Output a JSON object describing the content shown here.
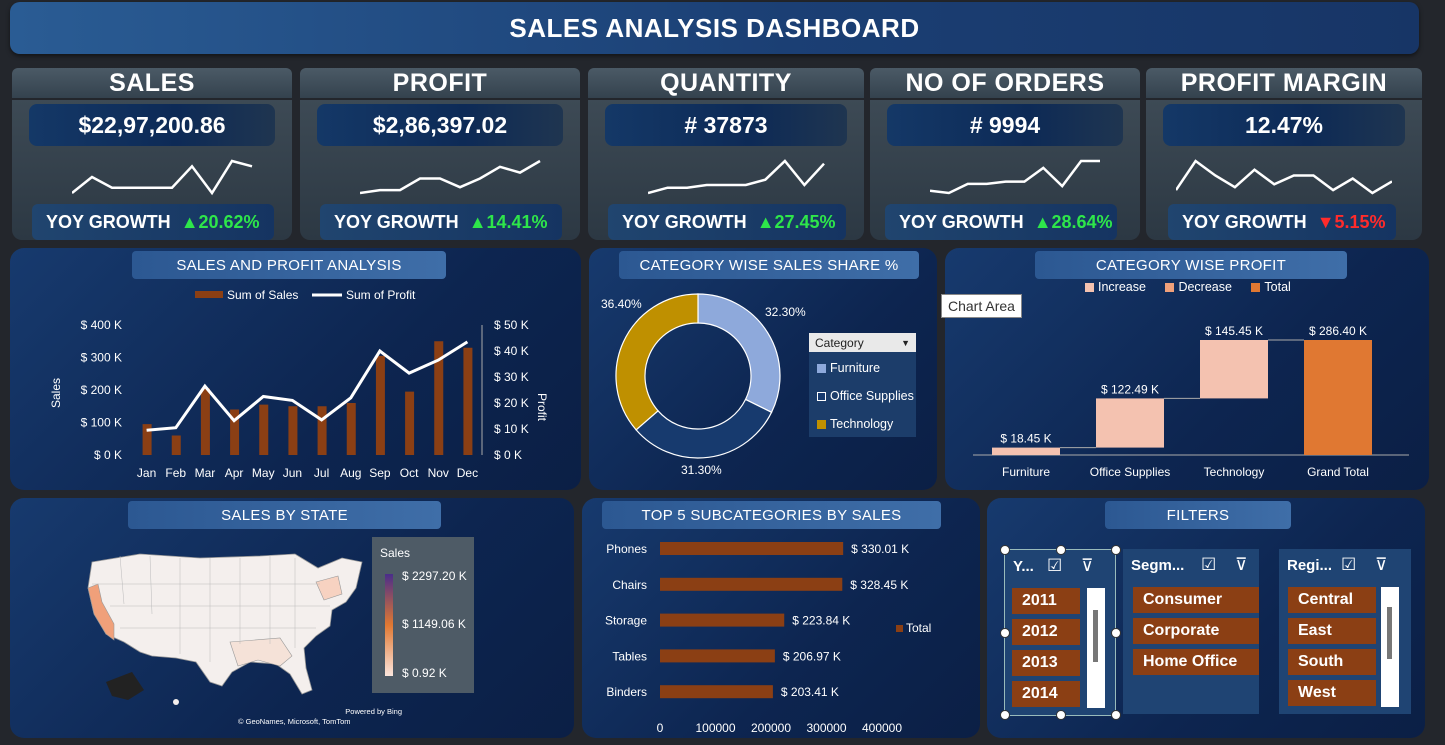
{
  "title": "SALES ANALYSIS DASHBOARD",
  "kpis": [
    {
      "label": "SALES",
      "value": "$22,97,200.86",
      "yoy_label": "YOY GROWTH",
      "yoy": "▲20.62%",
      "trend": "up",
      "spark": [
        4,
        7,
        5,
        5,
        5,
        5,
        9,
        4,
        10,
        9
      ]
    },
    {
      "label": "PROFIT",
      "value": "$2,86,397.02",
      "yoy_label": "YOY GROWTH",
      "yoy": "▲14.41%",
      "trend": "up",
      "spark": [
        3,
        4,
        4,
        8,
        8,
        5,
        8,
        12,
        10,
        14
      ]
    },
    {
      "label": "QUANTITY",
      "value": "# 37873",
      "yoy_label": "YOY GROWTH",
      "yoy": "▲27.45%",
      "trend": "up",
      "spark": [
        3,
        5,
        5,
        6,
        6,
        6,
        8,
        15,
        6,
        14
      ]
    },
    {
      "label": "NO OF ORDERS",
      "value": "# 9994",
      "yoy_label": "YOY GROWTH",
      "yoy": "▲28.64%",
      "trend": "up",
      "spark": [
        3,
        2,
        6,
        6,
        7,
        7,
        13,
        5,
        16,
        16
      ]
    },
    {
      "label": "PROFIT MARGIN",
      "value": "12.47%",
      "yoy_label": "YOY GROWTH",
      "yoy": "▼5.15%",
      "trend": "down",
      "spark": [
        3,
        13,
        8,
        4,
        10,
        5,
        8,
        8,
        3,
        7,
        2,
        6
      ]
    }
  ],
  "sales_profit": {
    "title": "SALES AND PROFIT ANALYSIS",
    "legend_sales": "Sum of Sales",
    "legend_profit": "Sum of Profit",
    "ylabel_left": "Sales",
    "ylabel_right": "Profit",
    "y_left_ticks": [
      "$ 0 K",
      "$ 100 K",
      "$ 200 K",
      "$ 300 K",
      "$ 400 K"
    ],
    "y_right_ticks": [
      "$ 0 K",
      "$ 10 K",
      "$ 20 K",
      "$ 30 K",
      "$ 40 K",
      "$ 50 K"
    ]
  },
  "chart_data": [
    {
      "type": "bar",
      "title": "SALES AND PROFIT ANALYSIS",
      "categories": [
        "Jan",
        "Feb",
        "Mar",
        "Apr",
        "May",
        "Jun",
        "Jul",
        "Aug",
        "Sep",
        "Oct",
        "Nov",
        "Dec"
      ],
      "series": [
        {
          "name": "Sum of Sales",
          "axis": "left",
          "kind": "bar",
          "values": [
            95,
            60,
            205,
            140,
            155,
            150,
            150,
            160,
            305,
            195,
            350,
            330
          ]
        },
        {
          "name": "Sum of Profit",
          "axis": "right",
          "kind": "line",
          "values": [
            9.5,
            10.5,
            26.5,
            13.2,
            22.5,
            21,
            13.5,
            22,
            40,
            31.5,
            36.5,
            43.5
          ]
        }
      ],
      "ylim_left": [
        0,
        400
      ],
      "ylim_right": [
        0,
        50
      ],
      "xlabel": "",
      "ylabel": "Sales",
      "ylabel_right": "Profit"
    },
    {
      "type": "pie",
      "title": "CATEGORY WISE SALES SHARE %",
      "categories": [
        "Furniture",
        "Office Supplies",
        "Technology"
      ],
      "values": [
        32.3,
        31.3,
        36.4
      ],
      "labels": [
        "32.30%",
        "31.30%",
        "36.40%"
      ],
      "colors": [
        "#8ea9db",
        "#173a6e",
        "#bf9000"
      ]
    },
    {
      "type": "bar",
      "subtype": "waterfall",
      "title": "CATEGORY WISE PROFIT",
      "categories": [
        "Furniture",
        "Office Supplies",
        "Technology",
        "Grand Total"
      ],
      "values": [
        18.45,
        122.49,
        145.45,
        286.4
      ],
      "labels": [
        "$ 18.45 K",
        "$ 122.49 K",
        "$ 145.45 K",
        "$ 286.40 K"
      ],
      "kinds": [
        "increase",
        "increase",
        "increase",
        "total"
      ],
      "legend": [
        "Increase",
        "Decrease",
        "Total"
      ]
    },
    {
      "type": "bar",
      "orientation": "horizontal",
      "title": "TOP 5 SUBCATEGORIES BY SALES",
      "categories": [
        "Phones",
        "Chairs",
        "Storage",
        "Tables",
        "Binders"
      ],
      "values": [
        330007,
        328449,
        223844,
        206966,
        203413
      ],
      "labels": [
        "$ 330.01 K",
        "$ 328.45 K",
        "$ 223.84 K",
        "$ 206.97 K",
        "$ 203.41 K"
      ],
      "x_ticks": [
        "0",
        "100000",
        "200000",
        "300000",
        "400000"
      ],
      "xlim": [
        0,
        400000
      ],
      "legend": "Total"
    }
  ],
  "category_share": {
    "title": "CATEGORY WISE SALES SHARE %",
    "legend_header": "Category",
    "legend": [
      "Furniture",
      "Office Supplies",
      "Technology"
    ],
    "tooltip": "Chart Area"
  },
  "category_profit": {
    "title": "CATEGORY WISE PROFIT",
    "legend": [
      "Increase",
      "Decrease",
      "Total"
    ]
  },
  "map": {
    "title": "SALES BY STATE",
    "legend_title": "Sales",
    "legend_max": "$ 2297.20 K",
    "legend_mid": "$ 1149.06 K",
    "legend_min": "$ 0.92 K",
    "credit1": "Powered by Bing",
    "credit2": "© GeoNames, Microsoft, TomTom"
  },
  "top5": {
    "title": "TOP 5 SUBCATEGORIES BY SALES",
    "legend": "Total"
  },
  "filters": {
    "title": "FILTERS",
    "year": {
      "header": "Y...",
      "items": [
        "2011",
        "2012",
        "2013",
        "2014"
      ]
    },
    "segment": {
      "header": "Segm...",
      "items": [
        "Consumer",
        "Corporate",
        "Home Office"
      ]
    },
    "region": {
      "header": "Regi...",
      "items": [
        "Central",
        "East",
        "South",
        "West"
      ]
    }
  },
  "colors": {
    "bar": "#8b3f14",
    "increase": "#f4c2b0",
    "total": "#e07832",
    "green": "#2ee64a",
    "red": "#ff2b2b"
  }
}
